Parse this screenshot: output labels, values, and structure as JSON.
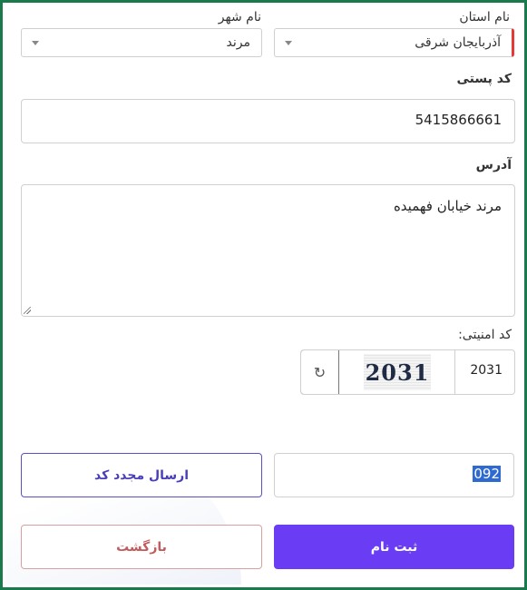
{
  "province": {
    "label": "نام استان",
    "value": "آذربایجان شرقی"
  },
  "city": {
    "label": "نام شهر",
    "value": "مرند"
  },
  "postal": {
    "label": "کد پستی",
    "value": "5415866661"
  },
  "address": {
    "label": "آدرس",
    "value": "مرند خیابان فهمیده"
  },
  "captcha": {
    "label": "کد امنیتی:",
    "image_text": "2031",
    "value": "2031",
    "refresh_icon": "refresh-icon"
  },
  "verify": {
    "code_value": "092",
    "resend_label": "ارسال مجدد کد"
  },
  "actions": {
    "submit_label": "ثبت نام",
    "back_label": "بازگشت"
  },
  "colors": {
    "frame": "#1a7a4c",
    "primary": "#6a3df5",
    "required": "#e53935",
    "back": "#c25b5b"
  }
}
